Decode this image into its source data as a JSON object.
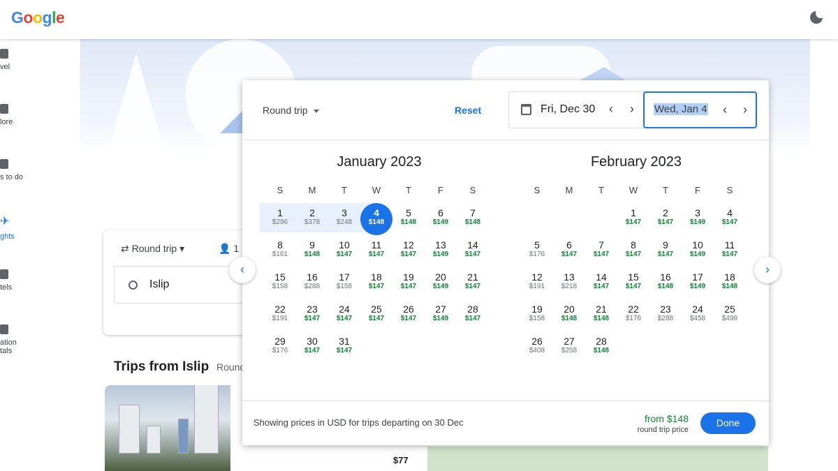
{
  "header": {
    "logo": "Google",
    "theme_icon": "moon-icon"
  },
  "nav": [
    {
      "label": "vel",
      "icon": "travel-icon"
    },
    {
      "label": "lore",
      "icon": "explore-icon"
    },
    {
      "label": "s to do",
      "icon": "camera-icon"
    },
    {
      "label": "ghts",
      "icon": "airplane-icon",
      "active": true
    },
    {
      "label": "tels",
      "icon": "bed-icon"
    },
    {
      "label": "ation",
      "label2": "tals",
      "icon": "house-icon"
    }
  ],
  "search": {
    "trip_type": "Round trip",
    "passengers": "1",
    "origin": "Islip"
  },
  "trips": {
    "title": "Trips from Islip",
    "subtitle": "Round",
    "price": "$77"
  },
  "dialog": {
    "trip_type": "Round trip",
    "reset": "Reset",
    "departure": "Fri, Dec 30",
    "return": "Wed, Jan 4",
    "weekdays": [
      "S",
      "M",
      "T",
      "W",
      "T",
      "F",
      "S"
    ],
    "months": [
      {
        "title": "January 2023",
        "year": 2023,
        "month": 1,
        "prices": [
          "$296",
          "$378",
          "$248",
          "$148",
          "$148",
          "$149",
          "$148",
          "$161",
          "$148",
          "$147",
          "$147",
          "$147",
          "$149",
          "$147",
          "$158",
          "$288",
          "$158",
          "$147",
          "$147",
          "$149",
          "$147",
          "$191",
          "$147",
          "$147",
          "$147",
          "$147",
          "$149",
          "$147",
          "$176",
          "$147",
          "$147"
        ],
        "low": [
          4,
          5,
          6,
          7,
          9,
          10,
          11,
          12,
          13,
          14,
          18,
          19,
          20,
          21,
          23,
          24,
          25,
          26,
          27,
          28,
          30,
          31
        ],
        "range": [
          1,
          3
        ],
        "selected": 4
      },
      {
        "title": "February 2023",
        "year": 2023,
        "month": 2,
        "prices": [
          "$147",
          "$147",
          "$149",
          "$147",
          "$176",
          "$147",
          "$147",
          "$147",
          "$147",
          "$149",
          "$147",
          "$191",
          "$218",
          "$147",
          "$147",
          "$148",
          "$149",
          "$148",
          "$158",
          "$148",
          "$148",
          "$176",
          "$288",
          "$458",
          "$498",
          "$408",
          "$258",
          "$148"
        ],
        "low": [
          1,
          2,
          3,
          4,
          6,
          7,
          8,
          9,
          10,
          11,
          14,
          15,
          16,
          17,
          18,
          20,
          21,
          28
        ]
      }
    ],
    "footer_note": "Showing prices in USD for trips departing on 30 Dec",
    "from_price": "from $148",
    "price_type": "round trip price",
    "done": "Done"
  },
  "colors": {
    "accent": "#1a73e8",
    "low_price": "#188038",
    "range": "#e8f0fe"
  }
}
